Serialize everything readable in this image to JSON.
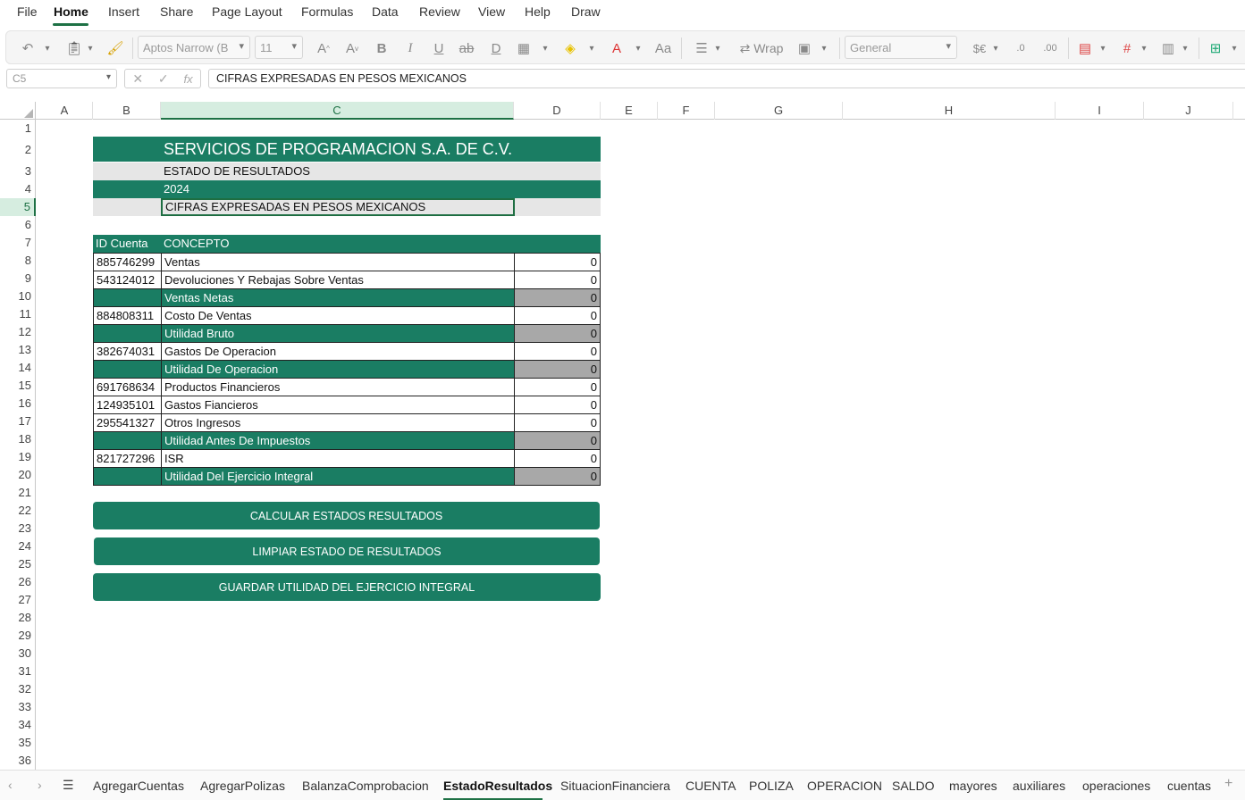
{
  "menu": {
    "items": [
      "File",
      "Home",
      "Insert",
      "Share",
      "Page Layout",
      "Formulas",
      "Data",
      "Review",
      "View",
      "Help",
      "Draw"
    ],
    "active": "Home"
  },
  "ribbon": {
    "font_name": "Aptos Narrow (B",
    "font_size": "11",
    "wrap_label": "Wrap",
    "number_format": "General"
  },
  "formula_bar": {
    "name_box": "C5",
    "fx_label": "fx",
    "formula": "CIFRAS EXPRESADAS EN PESOS MEXICANOS"
  },
  "grid": {
    "columns": [
      "A",
      "B",
      "C",
      "D",
      "E",
      "F",
      "G",
      "H",
      "I",
      "J"
    ],
    "selected_column": "C",
    "rows": [
      "1",
      "2",
      "3",
      "4",
      "5",
      "6",
      "7",
      "8",
      "9",
      "10",
      "11",
      "12",
      "13",
      "14",
      "15",
      "16",
      "17",
      "18",
      "19",
      "20",
      "21",
      "22",
      "23",
      "24",
      "25",
      "26",
      "27",
      "28",
      "29",
      "30",
      "31",
      "32",
      "33",
      "34",
      "35",
      "36"
    ],
    "selected_row": "5"
  },
  "report": {
    "company": "SERVICIOS  DE PROGRAMACION S.A. DE C.V.",
    "statement": "ESTADO DE RESULTADOS",
    "year": "2024",
    "currency_note": "CIFRAS EXPRESADAS EN PESOS MEXICANOS",
    "header_id": "ID Cuenta",
    "header_concept": "CONCEPTO",
    "lines": [
      {
        "id": "885746299",
        "concept": "Ventas",
        "value": "0",
        "total": false
      },
      {
        "id": "543124012",
        "concept": "Devoluciones Y Rebajas Sobre Ventas",
        "value": "0",
        "total": false
      },
      {
        "id": "",
        "concept": "Ventas Netas",
        "value": "0",
        "total": true
      },
      {
        "id": "884808311",
        "concept": "Costo De Ventas",
        "value": "0",
        "total": false
      },
      {
        "id": "",
        "concept": "Utilidad Bruto",
        "value": "0",
        "total": true
      },
      {
        "id": "382674031",
        "concept": "Gastos De Operacion",
        "value": "0",
        "total": false
      },
      {
        "id": "",
        "concept": "Utilidad De Operacion",
        "value": "0",
        "total": true
      },
      {
        "id": "691768634",
        "concept": "Productos Financieros",
        "value": "0",
        "total": false
      },
      {
        "id": "124935101",
        "concept": "Gastos Fiancieros",
        "value": "0",
        "total": false
      },
      {
        "id": "295541327",
        "concept": "Otros Ingresos",
        "value": "0",
        "total": false
      },
      {
        "id": "",
        "concept": "Utilidad Antes De Impuestos",
        "value": "0",
        "total": true
      },
      {
        "id": "821727296",
        "concept": "ISR",
        "value": "0",
        "total": false
      },
      {
        "id": "",
        "concept": "Utilidad Del Ejercicio Integral",
        "value": "0",
        "total": true
      }
    ]
  },
  "buttons": {
    "calculate": "CALCULAR ESTADOS RESULTADOS",
    "clear": "LIMPIAR ESTADO DE RESULTADOS",
    "save": "GUARDAR UTILIDAD DEL EJERCICIO INTEGRAL"
  },
  "sheets": {
    "tabs": [
      "AgregarCuentas",
      "AgregarPolizas",
      "BalanzaComprobacion",
      "EstadoResultados",
      "SituacionFinanciera",
      "CUENTA",
      "POLIZA",
      "OPERACION",
      "SALDO",
      "mayores",
      "auxiliares",
      "operaciones",
      "cuentas"
    ],
    "active": "EstadoResultados"
  },
  "colors": {
    "accent": "#1e7145",
    "report_green": "#1a7d63",
    "total_gray": "#a8a8a8",
    "band_gray": "#e6e6e6"
  }
}
